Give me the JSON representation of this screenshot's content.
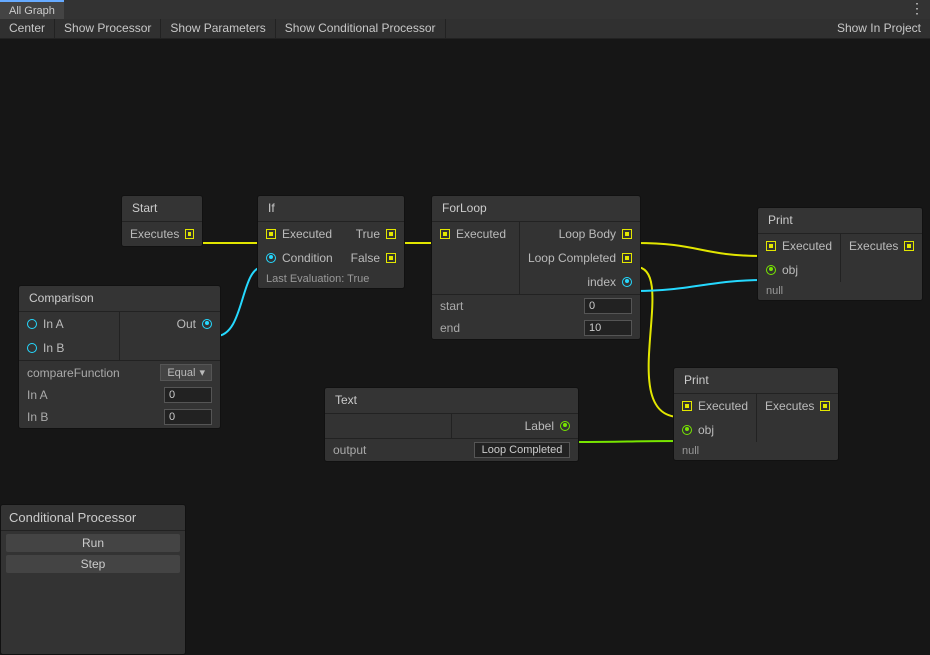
{
  "tab": {
    "label": "All Graph"
  },
  "toolbar": {
    "center": "Center",
    "show_processor": "Show Processor",
    "show_parameters": "Show Parameters",
    "show_conditional": "Show Conditional Processor",
    "show_in_project": "Show In Project"
  },
  "nodes": {
    "start": {
      "title": "Start",
      "executes": "Executes"
    },
    "if": {
      "title": "If",
      "executed": "Executed",
      "condition": "Condition",
      "true": "True",
      "false": "False",
      "last_eval": "Last Evaluation: True"
    },
    "forloop": {
      "title": "ForLoop",
      "executed": "Executed",
      "loop_body": "Loop Body",
      "loop_completed": "Loop Completed",
      "index": "index",
      "start_label": "start",
      "end_label": "end",
      "start_val": "0",
      "end_val": "10"
    },
    "comparison": {
      "title": "Comparison",
      "in_a": "In A",
      "in_b": "In B",
      "out": "Out",
      "compare_fn_label": "compareFunction",
      "compare_fn": "Equal",
      "in_a_label": "In A",
      "in_b_label": "In B",
      "in_a_val": "0",
      "in_b_val": "0"
    },
    "text": {
      "title": "Text",
      "label": "Label",
      "output_label": "output",
      "output_val": "Loop Completed"
    },
    "print1": {
      "title": "Print",
      "executed": "Executed",
      "executes": "Executes",
      "obj": "obj",
      "null": "null"
    },
    "print2": {
      "title": "Print",
      "executed": "Executed",
      "executes": "Executes",
      "obj": "obj",
      "null": "null"
    }
  },
  "cp": {
    "title": "Conditional Processor",
    "run": "Run",
    "step": "Step"
  }
}
